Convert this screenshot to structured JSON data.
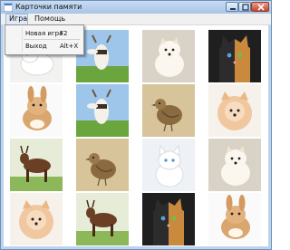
{
  "window": {
    "title": "Карточки памяти"
  },
  "menu": {
    "items": [
      "Игра",
      "Помощь"
    ],
    "open_menu": {
      "entries": [
        {
          "label": "Новая игра",
          "shortcut": "F2"
        },
        {
          "label": "Выход",
          "shortcut": "Alt+X"
        }
      ]
    }
  },
  "board": {
    "rows": [
      [
        "rabbit-white",
        "goat-on-grass",
        "puppy-white",
        "cat-two-tone"
      ],
      [
        "rabbit-ginger",
        "goat-on-grass",
        "bird-quail",
        "puppy-fluffy"
      ],
      [
        "goat-standing",
        "bird-quail",
        "cat-white",
        "puppy-white"
      ],
      [
        "puppy-fluffy",
        "goat-standing",
        "cat-two-tone",
        "rabbit-ginger"
      ]
    ]
  },
  "colors": {
    "accent": "#3c7fcf",
    "close": "#c7452e"
  }
}
